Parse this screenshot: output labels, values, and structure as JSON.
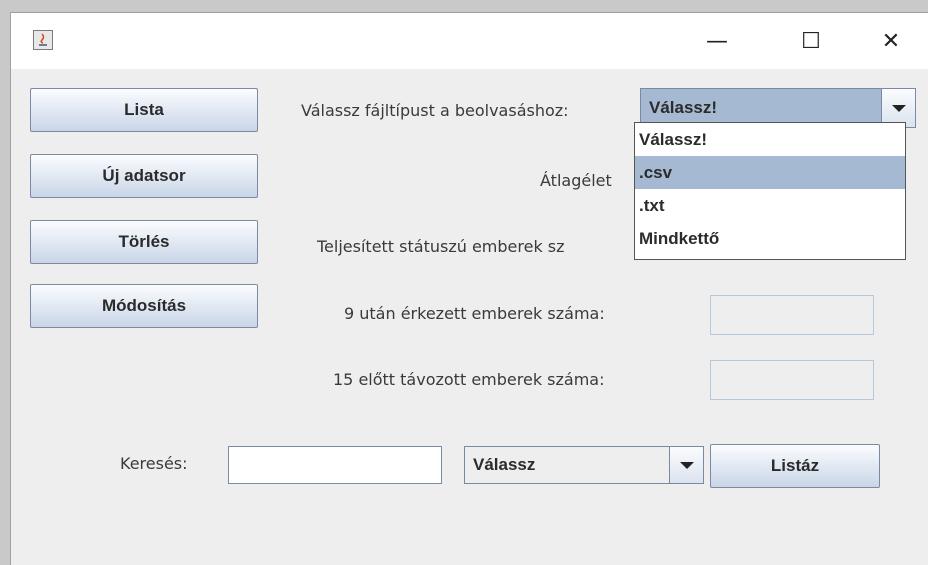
{
  "window": {
    "controls": {
      "minimize": "—",
      "maximize": "☐",
      "close": "✕"
    }
  },
  "buttons": {
    "lista": "Lista",
    "uj_adatsor": "Új adatsor",
    "torles": "Törlés",
    "modositas": "Módosítás",
    "listaz": "Listáz"
  },
  "labels": {
    "file_type": "Válassz fájltípust a beolvasáshoz:",
    "average_partial": "Átlagélet",
    "completed_partial": "Teljesített státuszú emberek sz",
    "after_nine": "9 után érkezett emberek száma:",
    "before_fifteen": "15 előtt távozott emberek száma:",
    "search": "Keresés:"
  },
  "file_type_combo": {
    "selected": "Válassz!",
    "options": [
      "Válassz!",
      ".csv",
      ".txt",
      "Mindkettő"
    ],
    "highlighted_index": 1
  },
  "search_combo": {
    "selected": "Válassz"
  },
  "search_input": {
    "value": ""
  },
  "colors": {
    "highlight": "#a6b9d3",
    "selected_combo": "#a6b9d3"
  }
}
